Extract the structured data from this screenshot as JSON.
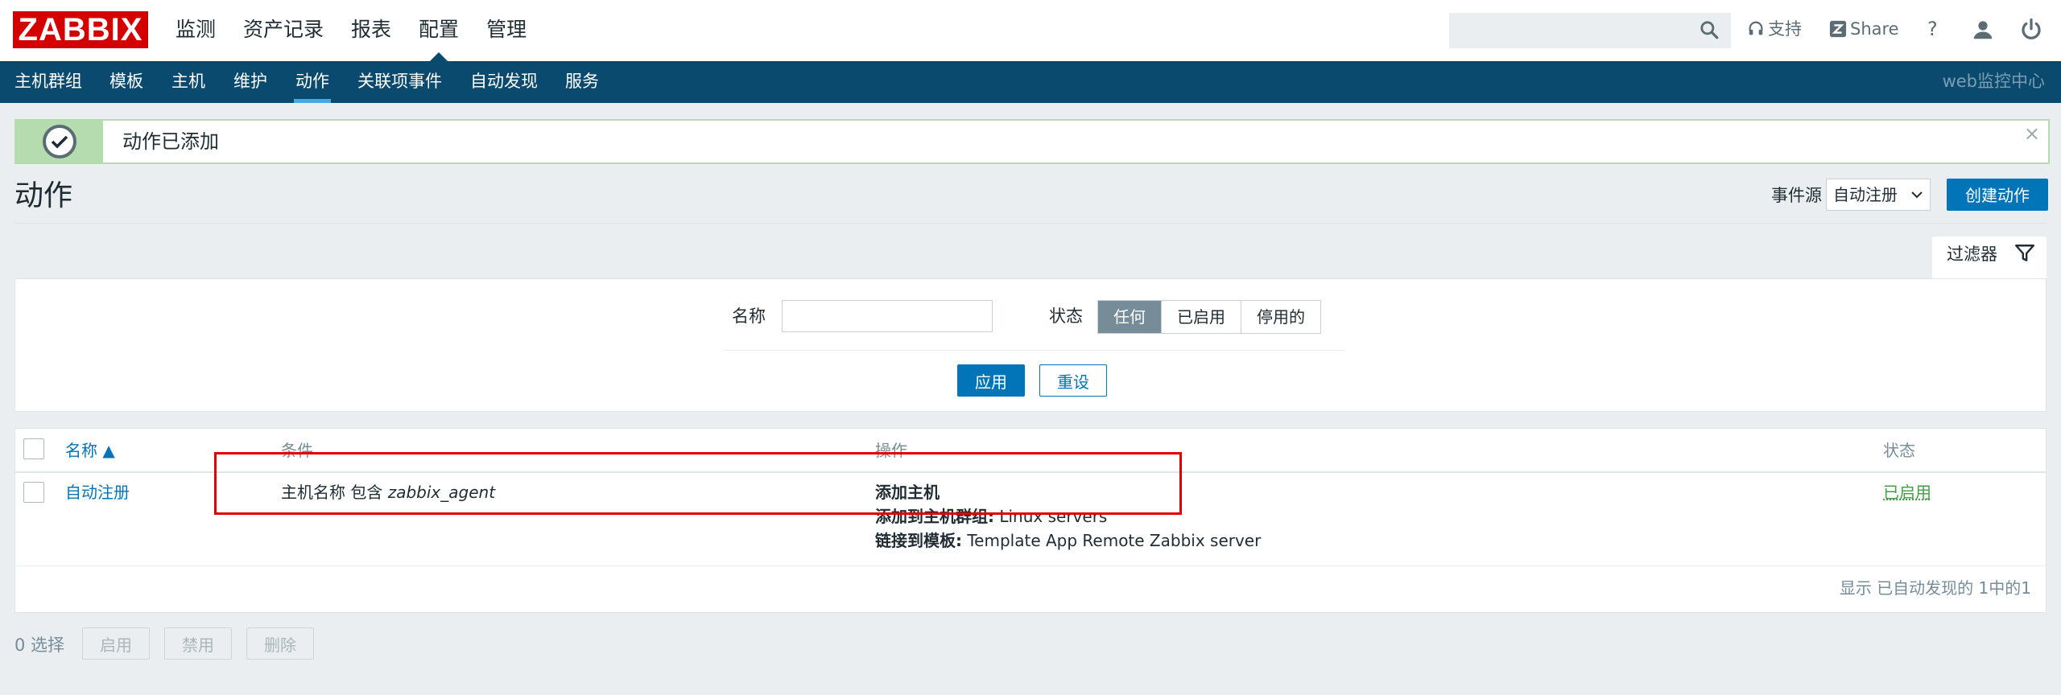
{
  "header": {
    "logo": "ZABBIX",
    "menu": [
      "监测",
      "资产记录",
      "报表",
      "配置",
      "管理"
    ],
    "active_menu": "配置",
    "search_placeholder": "",
    "support": "支持",
    "share": "Share",
    "help": "?"
  },
  "subnav": {
    "items": [
      "主机群组",
      "模板",
      "主机",
      "维护",
      "动作",
      "关联项事件",
      "自动发现",
      "服务"
    ],
    "active": "动作",
    "server_name": "web监控中心"
  },
  "message": {
    "text": "动作已添加",
    "close": "×"
  },
  "page": {
    "title": "动作",
    "event_source_label": "事件源",
    "event_source_value": "自动注册",
    "create_button": "创建动作"
  },
  "filter": {
    "tab_label": "过滤器",
    "name_label": "名称",
    "name_value": "",
    "status_label": "状态",
    "status_options": [
      "任何",
      "已启用",
      "停用的"
    ],
    "status_selected": "任何",
    "apply": "应用",
    "reset": "重设"
  },
  "table": {
    "columns": {
      "name": "名称 ▲",
      "conditions": "条件",
      "operations": "操作",
      "status": "状态"
    },
    "rows": [
      {
        "name": "自动注册",
        "condition_prefix": "主机名称 包含 ",
        "condition_value": "zabbix_agent",
        "op1": "添加主机",
        "op2_label": "添加到主机群组:",
        "op2_value": " Linux servers",
        "op3_label": "链接到模板:",
        "op3_value": " Template App Remote Zabbix server",
        "status": "已启用"
      }
    ],
    "paging": "显示 已自动发现的 1中的1"
  },
  "footer": {
    "selected": "0 选择",
    "enable": "启用",
    "disable": "禁用",
    "delete": "删除"
  },
  "colors": {
    "brand": "#d40000",
    "nav": "#0b4a6f",
    "accent": "#0275b8",
    "success": "#429e47"
  }
}
